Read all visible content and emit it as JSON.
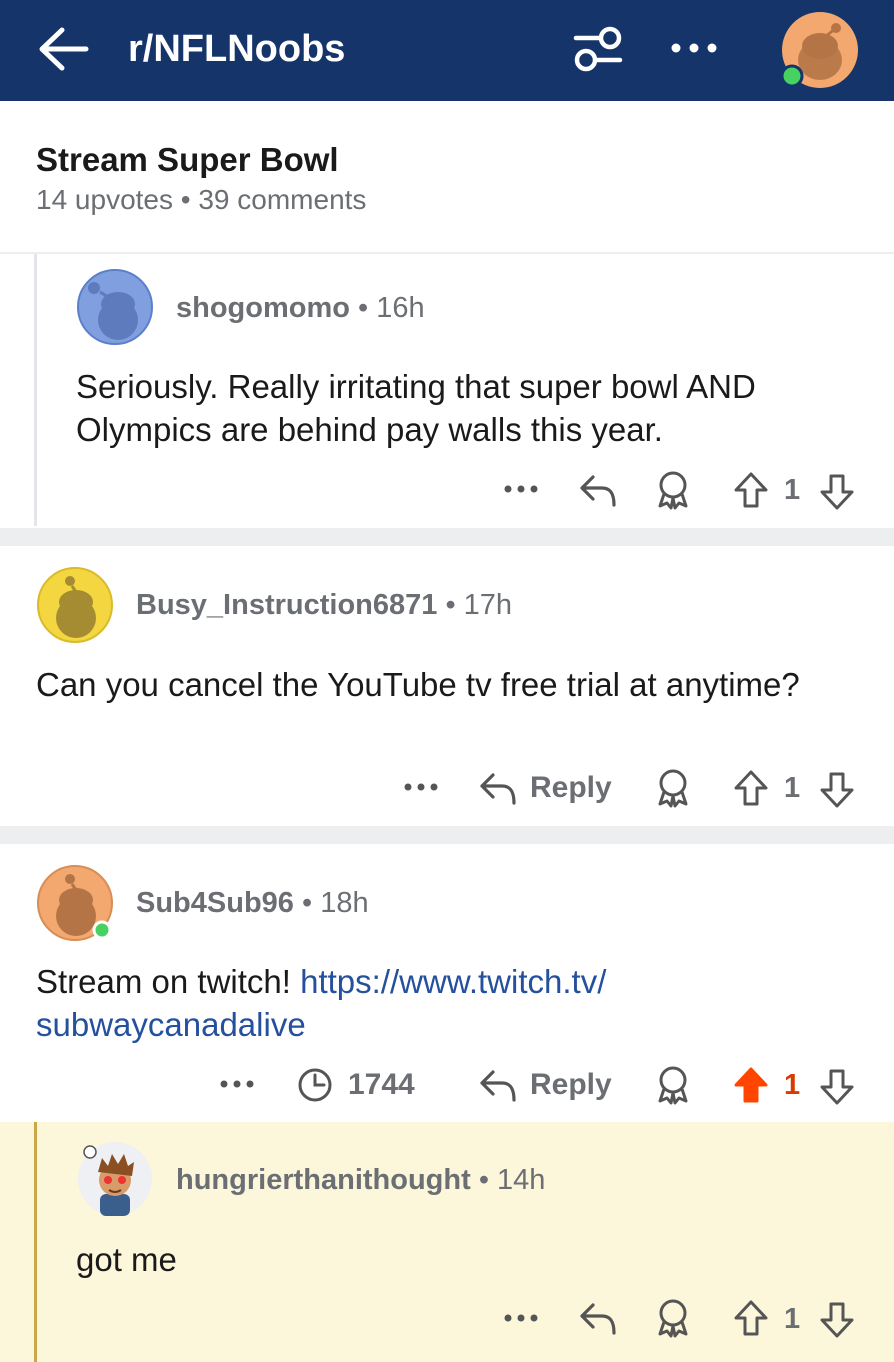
{
  "header": {
    "title": "r/NFLNoobs",
    "back_icon": "arrow-left-icon",
    "filter_icon": "sliders-icon",
    "more_icon": "more-horizontal-icon",
    "avatar": "user-avatar",
    "colors": {
      "bar": "#15346a",
      "online": "#46d160"
    }
  },
  "post": {
    "title": "Stream Super Bowl",
    "meta": "14 upvotes • 39 comments"
  },
  "comments": [
    {
      "username": "shogomomo",
      "age": " • 16h",
      "body": "Seriously. Really irritating that super bowl AND Olympics are behind pay walls this year.",
      "votes": "1"
    },
    {
      "username": "Busy_Instruction6871",
      "age": " • 17h",
      "body": "Can you cancel the YouTube tv free trial at anytime?",
      "reply_label": "Reply",
      "votes": "1"
    },
    {
      "username": "Sub4Sub96",
      "age": " • 18h",
      "body_prefix": "Stream on twitch! ",
      "link_line1": "https://www.twitch.tv/",
      "link_line2": "subwaycanadalive",
      "timer_count": "1744",
      "reply_label": "Reply",
      "votes": "1",
      "upvoted": true
    },
    {
      "username": "hungrierthanithought",
      "age": " • 14h",
      "body": "got me",
      "votes": "1"
    }
  ],
  "colors": {
    "upvote_active": "#ff4500",
    "link": "#24509e",
    "highlight_bg": "#fcf6da"
  }
}
